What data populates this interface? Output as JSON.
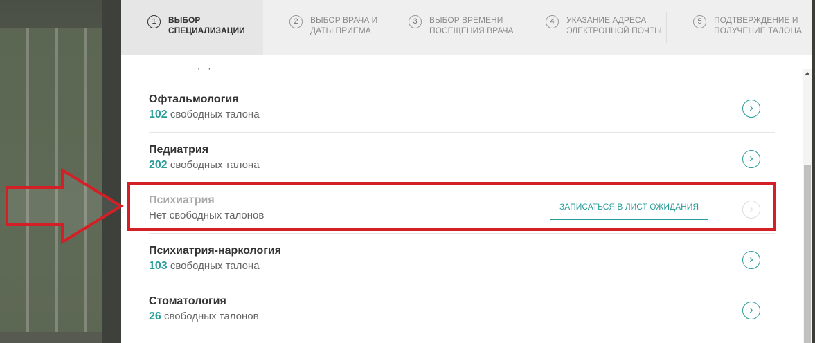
{
  "steps": [
    {
      "num": "1",
      "label": "Выбор специализации"
    },
    {
      "num": "2",
      "label": "Выбор врача и даты приема"
    },
    {
      "num": "3",
      "label": "Выбор времени посещения врача"
    },
    {
      "num": "4",
      "label": "Указание адреса электронной почты"
    },
    {
      "num": "5",
      "label": "Подтверждение и получение талона"
    }
  ],
  "list": {
    "partial_text": "· ·",
    "items": [
      {
        "name": "Офтальмология",
        "count": "102",
        "suffix": "свободных талона"
      },
      {
        "name": "Педиатрия",
        "count": "202",
        "suffix": "свободных талона"
      },
      {
        "name": "Психиатрия",
        "status": "Нет свободных талонов",
        "wait_button": "Записаться в лист ожидания"
      },
      {
        "name": "Психиатрия-наркология",
        "count": "103",
        "suffix": "свободных талона"
      },
      {
        "name": "Стоматология",
        "count": "26",
        "suffix": "свободных талонов"
      }
    ]
  },
  "colors": {
    "accent": "#2a9d9a",
    "highlight": "#d41f27"
  },
  "icons": {
    "go": "chevron-circle-right-icon",
    "arrow": "red-arrow-annotation"
  }
}
